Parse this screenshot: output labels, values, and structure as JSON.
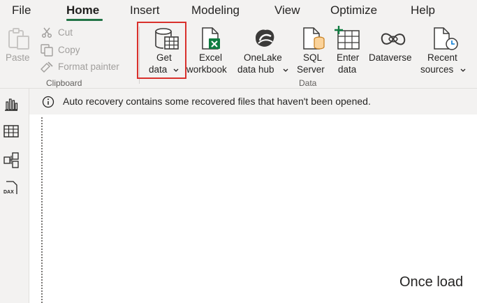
{
  "menu": {
    "tabs": [
      {
        "label": "File"
      },
      {
        "label": "Home"
      },
      {
        "label": "Insert"
      },
      {
        "label": "Modeling"
      },
      {
        "label": "View"
      },
      {
        "label": "Optimize"
      },
      {
        "label": "Help"
      }
    ],
    "active": "Home"
  },
  "ribbon": {
    "clipboard": {
      "paste": "Paste",
      "cut": "Cut",
      "copy": "Copy",
      "format_painter": "Format painter",
      "group_label": "Clipboard"
    },
    "data": {
      "get_data": {
        "line1": "Get",
        "line2": "data"
      },
      "excel": {
        "line1": "Excel",
        "line2": "workbook"
      },
      "onelake": {
        "line1": "OneLake",
        "line2": "data hub"
      },
      "sql": {
        "line1": "SQL",
        "line2": "Server"
      },
      "enter": {
        "line1": "Enter",
        "line2": "data"
      },
      "dataverse": {
        "line1": "Dataverse"
      },
      "recent": {
        "line1": "Recent",
        "line2": "sources"
      },
      "group_label": "Data"
    }
  },
  "sidebar": {
    "items": [
      {
        "icon": "report-view-icon"
      },
      {
        "icon": "table-view-icon"
      },
      {
        "icon": "model-view-icon"
      },
      {
        "icon": "dax-query-icon",
        "label": "DAX"
      }
    ]
  },
  "info_bar": {
    "icon": "info-icon",
    "text": "Auto recovery contains some recovered files that haven't been opened."
  },
  "canvas": {
    "partial_text": "Once load"
  },
  "colors": {
    "accent": "#217346",
    "highlight": "#d9302c",
    "excel_green": "#107c41",
    "ribbon_bg": "#f3f2f1"
  }
}
